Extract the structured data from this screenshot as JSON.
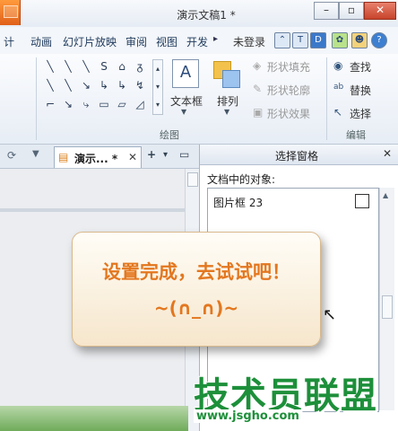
{
  "window": {
    "title": "演示文稿1 *",
    "minimize_icon": "minimize-icon",
    "restore_icon": "restore-icon",
    "close_icon": "close-icon"
  },
  "menu_tabs": [
    "计",
    "动画",
    "幻灯片放映",
    "审阅",
    "视图",
    "开发"
  ],
  "account": {
    "login": "未登录"
  },
  "ribbon": {
    "textbox_label": "文本框",
    "arrange_label": "排列",
    "shape_fill": "形状填充",
    "shape_outline": "形状轮廓",
    "shape_effects": "形状效果",
    "find": "查找",
    "replace": "替换",
    "select": "选择",
    "group_drawing": "绘图",
    "group_editing": "编辑",
    "shape_glyphs": [
      "╲",
      "╲",
      "╲",
      "S",
      "⌂",
      "ᵹ",
      "╲",
      "╲",
      "↘",
      "↳",
      "↳",
      "↯",
      "⌐",
      "↘",
      "⤷",
      "▭",
      "▱",
      "◿"
    ]
  },
  "doc_tab": {
    "label": "演示... *"
  },
  "selection_pane": {
    "title": "选择窗格",
    "objects_label": "文档中的对象:",
    "items": [
      {
        "name": "图片框 23"
      }
    ]
  },
  "callout": {
    "line1": "设置完成，去试试吧！",
    "line2": "~(∩_∩)~"
  },
  "watermark": {
    "text": "技术员联盟",
    "url": "www.jsgho.com"
  },
  "colors": {
    "accent": "#e3771f",
    "watermark": "#1d8f3a"
  }
}
